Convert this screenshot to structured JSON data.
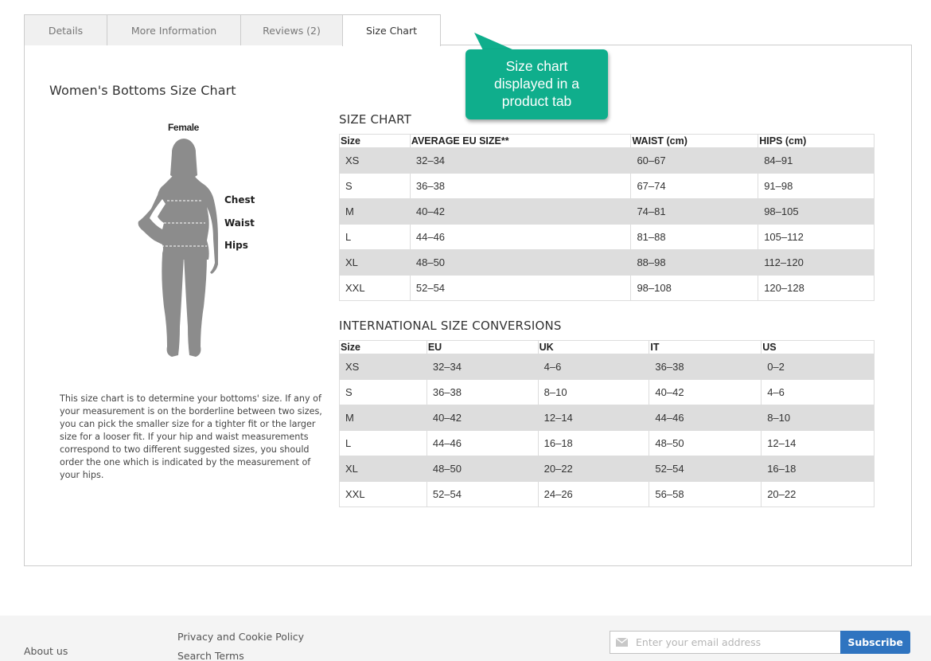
{
  "tabs": [
    {
      "label": "Details",
      "active": false
    },
    {
      "label": "More Information",
      "active": false
    },
    {
      "label": "Reviews (2)",
      "active": false
    },
    {
      "label": "Size Chart",
      "active": true
    }
  ],
  "callout": {
    "lines": [
      "Size chart",
      "displayed in a",
      "product tab"
    ],
    "color": "#0fae8c"
  },
  "content": {
    "title": "Women's Bottoms Size Chart",
    "figure": {
      "gender_label": "Female",
      "measure_labels": [
        "Chest",
        "Waist",
        "Hips"
      ]
    },
    "description": "This size chart is to determine your bottoms' size. If any of your measurement is on the borderline between two sizes, you can pick the smaller size for a tighter fit or the larger size for a looser fit. If your hip and waist measurements correspond to two different suggested sizes, you should order the one which is indicated by the measurement of your hips."
  },
  "size_chart": {
    "heading": "SIZE CHART",
    "headers": [
      "Size",
      "AVERAGE EU SIZE**",
      "WAIST (cm)",
      "HIPS (cm)"
    ],
    "rows": [
      [
        "XS",
        "32–34",
        "60–67",
        "84–91"
      ],
      [
        "S",
        "36–38",
        "67–74",
        "91–98"
      ],
      [
        "M",
        "40–42",
        "74–81",
        "98–105"
      ],
      [
        "L",
        "44–46",
        "81–88",
        "105–112"
      ],
      [
        "XL",
        "48–50",
        "88–98",
        "112–120"
      ],
      [
        "XXL",
        "52–54",
        "98–108",
        "120–128"
      ]
    ]
  },
  "conversions": {
    "heading": "INTERNATIONAL SIZE CONVERSIONS",
    "headers": [
      "Size",
      "EU",
      "UK",
      "IT",
      "US"
    ],
    "rows": [
      [
        "XS",
        "32–34",
        "4–6",
        "36–38",
        "0–2"
      ],
      [
        "S",
        "36–38",
        "8–10",
        "40–42",
        "4–6"
      ],
      [
        "M",
        "40–42",
        "12–14",
        "44–46",
        "8–10"
      ],
      [
        "L",
        "44–46",
        "16–18",
        "48–50",
        "12–14"
      ],
      [
        "XL",
        "48–50",
        "20–22",
        "52–54",
        "16–18"
      ],
      [
        "XXL",
        "52–54",
        "24–26",
        "56–58",
        "20–22"
      ]
    ]
  },
  "footer": {
    "links": [
      "About us",
      "Privacy and Cookie Policy",
      "Search Terms"
    ],
    "newsletter": {
      "placeholder": "Enter your email address",
      "value": "",
      "icon": "mail-icon",
      "button_label": "Subscribe",
      "button_color": "#2f74c0"
    }
  }
}
